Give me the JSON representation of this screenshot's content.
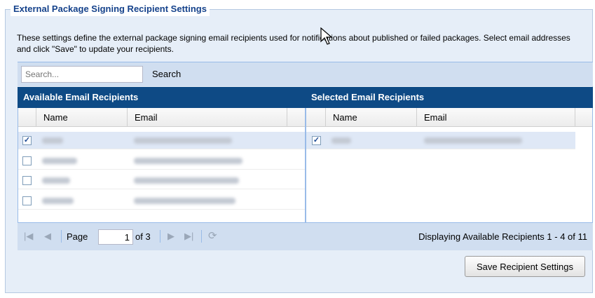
{
  "legend": "External Package Signing Recipient Settings",
  "description": "These settings define the external package signing email recipients used for notifications about published or failed packages. Select email addresses and click \"Save\" to update your recipients.",
  "search": {
    "placeholder": "Search...",
    "button_label": "Search"
  },
  "available": {
    "title": "Available Email Recipients",
    "columns": {
      "name": "Name",
      "email": "Email"
    },
    "rows": [
      {
        "checked": true
      },
      {
        "checked": false
      },
      {
        "checked": false
      },
      {
        "checked": false
      }
    ]
  },
  "selected": {
    "title": "Selected Email Recipients",
    "columns": {
      "name": "Name",
      "email": "Email"
    },
    "rows": [
      {
        "checked": true
      }
    ]
  },
  "pager": {
    "page_label": "Page",
    "page_value": "1",
    "of_label": "of 3",
    "display_text": "Displaying Available Recipients 1 - 4 of 11"
  },
  "save_button": "Save Recipient Settings",
  "colors": {
    "header_bar": "#0e4a85",
    "legend_text": "#15428b",
    "panel_bg": "#e6eef8"
  }
}
